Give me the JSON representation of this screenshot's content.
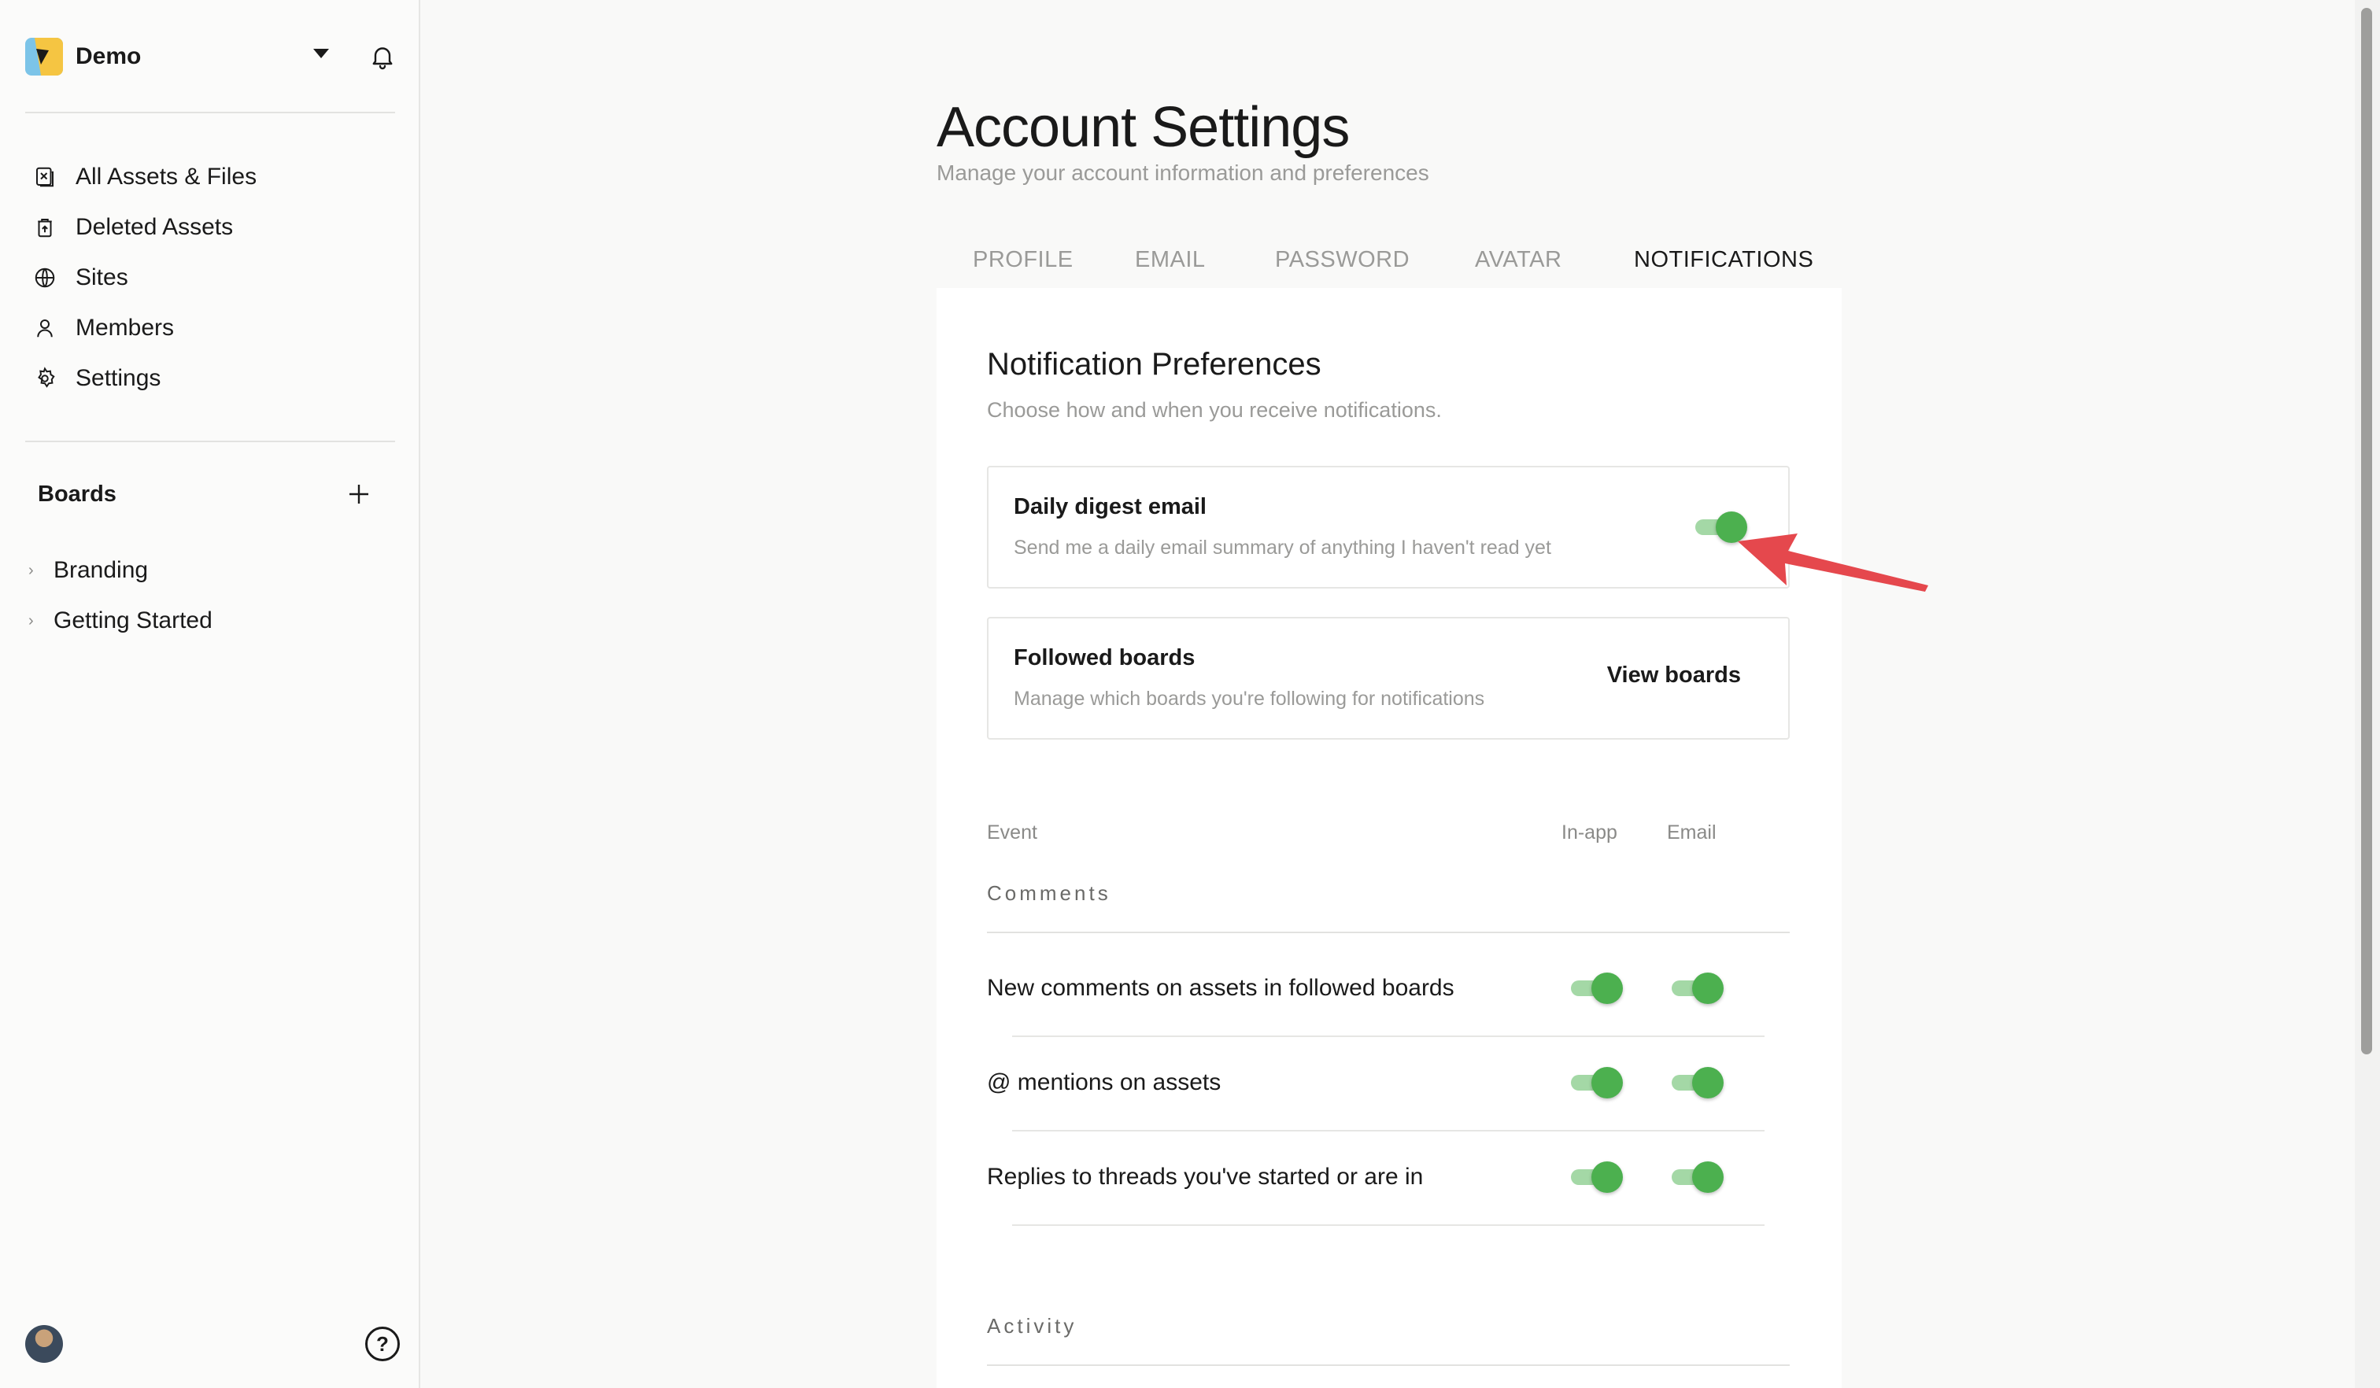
{
  "sidebar": {
    "workspace_name": "Demo",
    "nav": [
      {
        "label": "All Assets & Files",
        "icon": "files-icon"
      },
      {
        "label": "Deleted Assets",
        "icon": "trash-icon"
      },
      {
        "label": "Sites",
        "icon": "globe-icon"
      },
      {
        "label": "Members",
        "icon": "person-icon"
      },
      {
        "label": "Settings",
        "icon": "gear-icon"
      }
    ],
    "boards_title": "Boards",
    "boards": [
      {
        "label": "Branding"
      },
      {
        "label": "Getting Started"
      }
    ],
    "help_label": "?"
  },
  "page": {
    "title": "Account Settings",
    "subtitle": "Manage your account information and preferences",
    "tabs": [
      {
        "label": "PROFILE"
      },
      {
        "label": "EMAIL"
      },
      {
        "label": "PASSWORD"
      },
      {
        "label": "AVATAR"
      },
      {
        "label": "NOTIFICATIONS",
        "active": true
      }
    ]
  },
  "notifications": {
    "title": "Notification Preferences",
    "subtitle": "Choose how and when you receive notifications.",
    "digest": {
      "title": "Daily digest email",
      "desc": "Send me a daily email summary of anything I haven't read yet",
      "enabled": true
    },
    "followed": {
      "title": "Followed boards",
      "desc": "Manage which boards you're following for notifications",
      "button": "View boards"
    },
    "columns": {
      "event": "Event",
      "inapp": "In-app",
      "email": "Email"
    },
    "groups": [
      {
        "name": "Comments",
        "rows": [
          {
            "label": "New comments on assets in followed boards",
            "inapp": true,
            "email": true
          },
          {
            "label": "@ mentions on assets",
            "inapp": true,
            "email": true
          },
          {
            "label": "Replies to threads you've started or are in",
            "inapp": true,
            "email": true
          }
        ]
      },
      {
        "name": "Activity",
        "rows": []
      }
    ]
  },
  "colors": {
    "toggle_on": "#4cb04f",
    "annotation_arrow": "#e5484d"
  }
}
